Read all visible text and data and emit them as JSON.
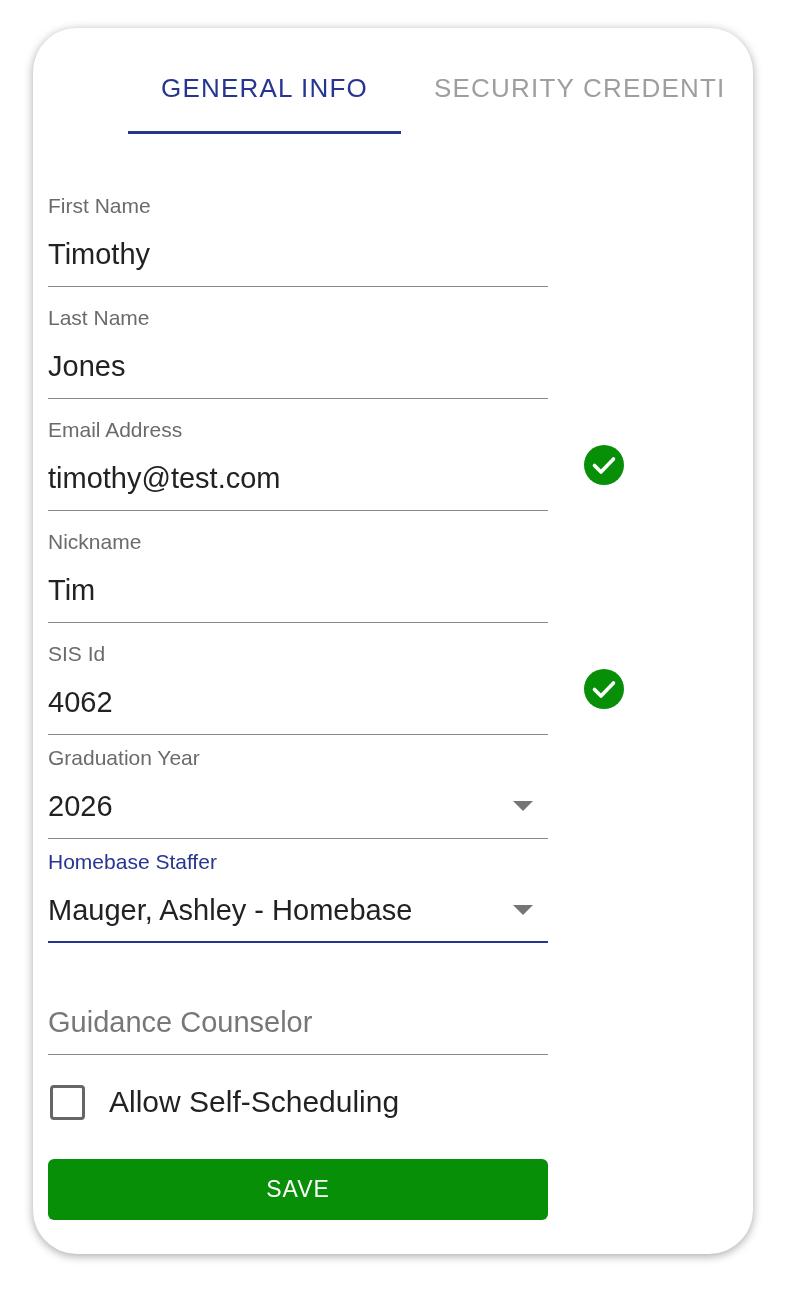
{
  "tabs": [
    {
      "label": "GENERAL INFO",
      "selected": true
    },
    {
      "label": "SECURITY CREDENTI",
      "selected": false
    }
  ],
  "fields": [
    {
      "kind": "text",
      "label": "First Name",
      "value": "Timothy",
      "focused": false,
      "verified": false
    },
    {
      "kind": "text",
      "label": "Last Name",
      "value": "Jones",
      "focused": false,
      "verified": false
    },
    {
      "kind": "text",
      "label": "Email Address",
      "value": "timothy@test.com",
      "focused": false,
      "verified": true
    },
    {
      "kind": "text",
      "label": "Nickname",
      "value": "Tim",
      "focused": false,
      "verified": false
    },
    {
      "kind": "text",
      "label": "SIS Id",
      "value": "4062",
      "focused": false,
      "verified": true
    },
    {
      "kind": "select",
      "label": "Graduation Year",
      "value": "2026",
      "focused": false,
      "verified": false
    },
    {
      "kind": "select",
      "label": "Homebase Staffer",
      "value": "Mauger, Ashley - Homebase",
      "focused": true,
      "verified": false
    },
    {
      "kind": "text",
      "placeholder": "Guidance Counselor",
      "focused": false,
      "verified": false
    }
  ],
  "checkbox": {
    "label": "Allow Self-Scheduling",
    "checked": false
  },
  "save_button": {
    "label": "SAVE"
  }
}
